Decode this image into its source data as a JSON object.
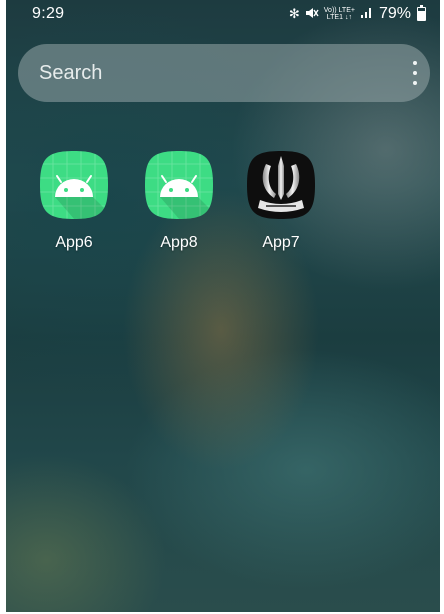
{
  "status_bar": {
    "time": "9:29",
    "network_top": "Vo)) LTE+",
    "network_bottom": "LTE1 ↓↑",
    "battery_percent": "79%",
    "battery_level": 0.79,
    "icons": [
      "bluetooth-icon",
      "mute-icon",
      "signal-icon",
      "battery-icon"
    ]
  },
  "search": {
    "placeholder": "Search",
    "menu_icon": "more-vertical-icon"
  },
  "apps": [
    {
      "label": "App6",
      "icon": "android-icon",
      "color": "#3ddc84"
    },
    {
      "label": "App8",
      "icon": "android-icon",
      "color": "#3ddc84"
    },
    {
      "label": "App7",
      "icon": "emblem-icon",
      "color": "#111111"
    }
  ]
}
